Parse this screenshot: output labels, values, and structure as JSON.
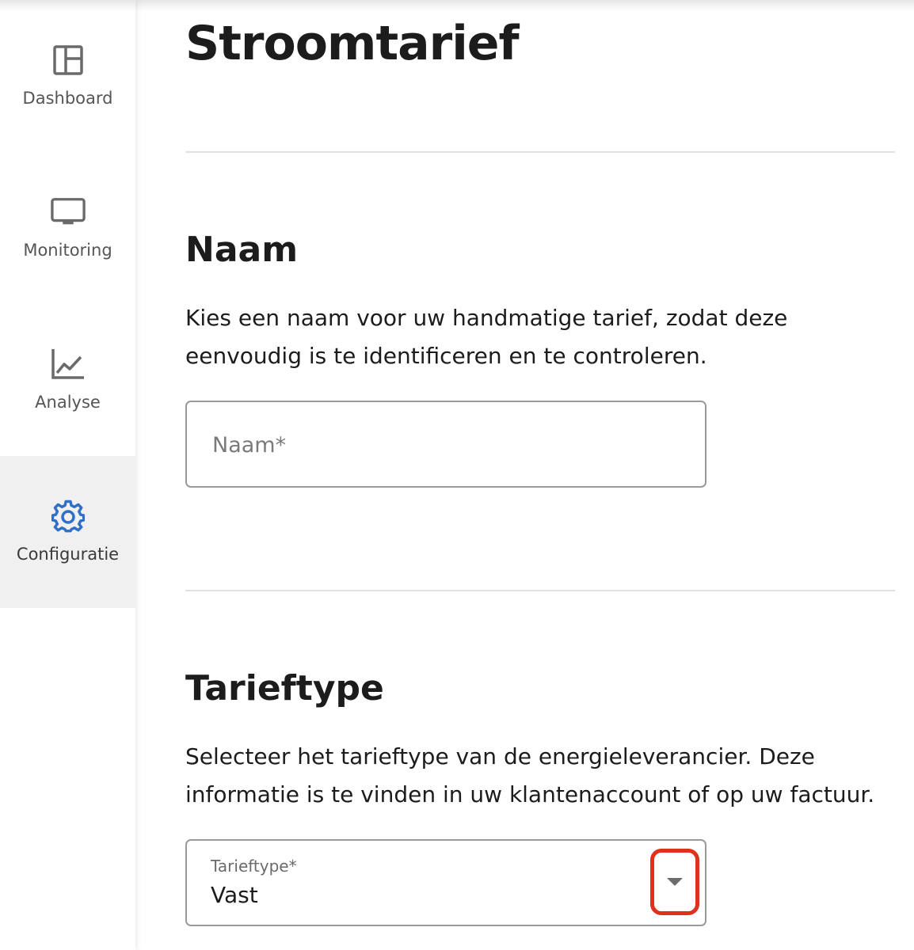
{
  "sidebar": {
    "items": [
      {
        "label": "Dashboard",
        "icon": "dashboard-icon",
        "active": false
      },
      {
        "label": "Monitoring",
        "icon": "monitor-icon",
        "active": false
      },
      {
        "label": "Analyse",
        "icon": "chart-line-icon",
        "active": false
      },
      {
        "label": "Configuratie",
        "icon": "gear-icon",
        "active": true
      }
    ]
  },
  "page": {
    "title": "Stroomtarief"
  },
  "naam_section": {
    "title": "Naam",
    "description": "Kies een naam voor uw handmatige tarief, zodat deze eenvoudig is te identificeren en te controleren.",
    "input_placeholder": "Naam*",
    "input_value": ""
  },
  "tarieftype_section": {
    "title": "Tarieftype",
    "description": "Selecteer het tarieftype van de energieleverancier. Deze informatie is te vinden in uw klantenaccount of op uw factuur.",
    "select_label": "Tarieftype*",
    "select_value": "Vast"
  },
  "colors": {
    "accent": "#2f6fc6",
    "highlight": "#e0311c",
    "active_nav_bg": "#f0f0f0"
  }
}
